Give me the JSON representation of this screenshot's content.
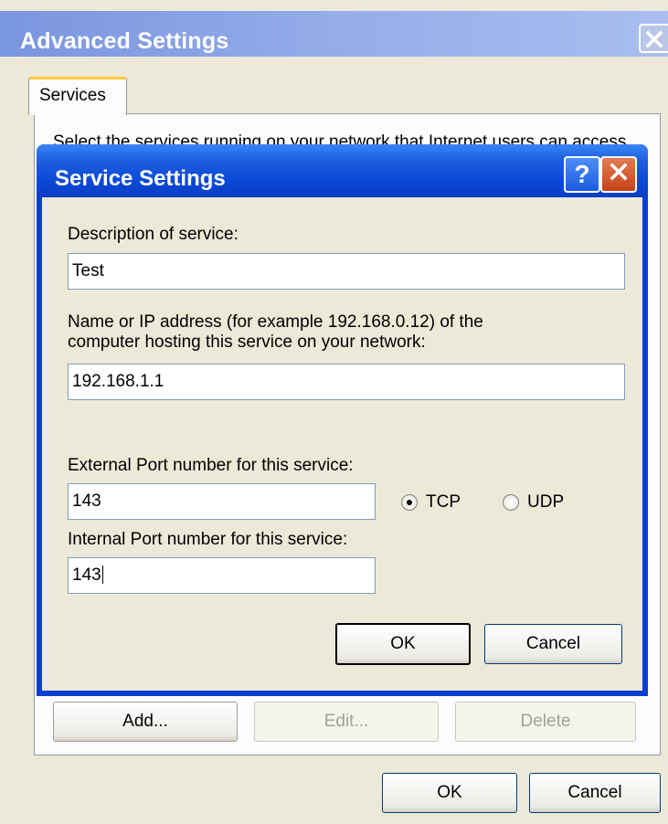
{
  "outer_window": {
    "title": "Advanced Settings",
    "tab_label": "Services",
    "description": "Select the services running on your network that Internet users can access.",
    "buttons": {
      "add": "Add...",
      "edit": "Edit...",
      "delete": "Delete",
      "ok": "OK",
      "cancel": "Cancel"
    }
  },
  "dialog": {
    "title": "Service Settings",
    "help_glyph": "?",
    "description_label": "Description of service:",
    "description_value": "Test",
    "host_label_line1": "Name or IP address (for example 192.168.0.12) of the",
    "host_label_line2": "computer hosting this service on your network:",
    "host_value": "192.168.1.1",
    "external_port_label": "External Port number for this service:",
    "external_port_value": "143",
    "internal_port_label": "Internal Port number for this service:",
    "internal_port_value": "143",
    "protocol": {
      "tcp_label": "TCP",
      "udp_label": "UDP",
      "selected": "TCP"
    },
    "ok_label": "OK",
    "cancel_label": "Cancel"
  },
  "colors": {
    "dialog_title_blue": "#0a49d6",
    "outer_title_blue": "#7a96df",
    "tab_accent": "#ffc83c",
    "window_face": "#ece9d8"
  }
}
